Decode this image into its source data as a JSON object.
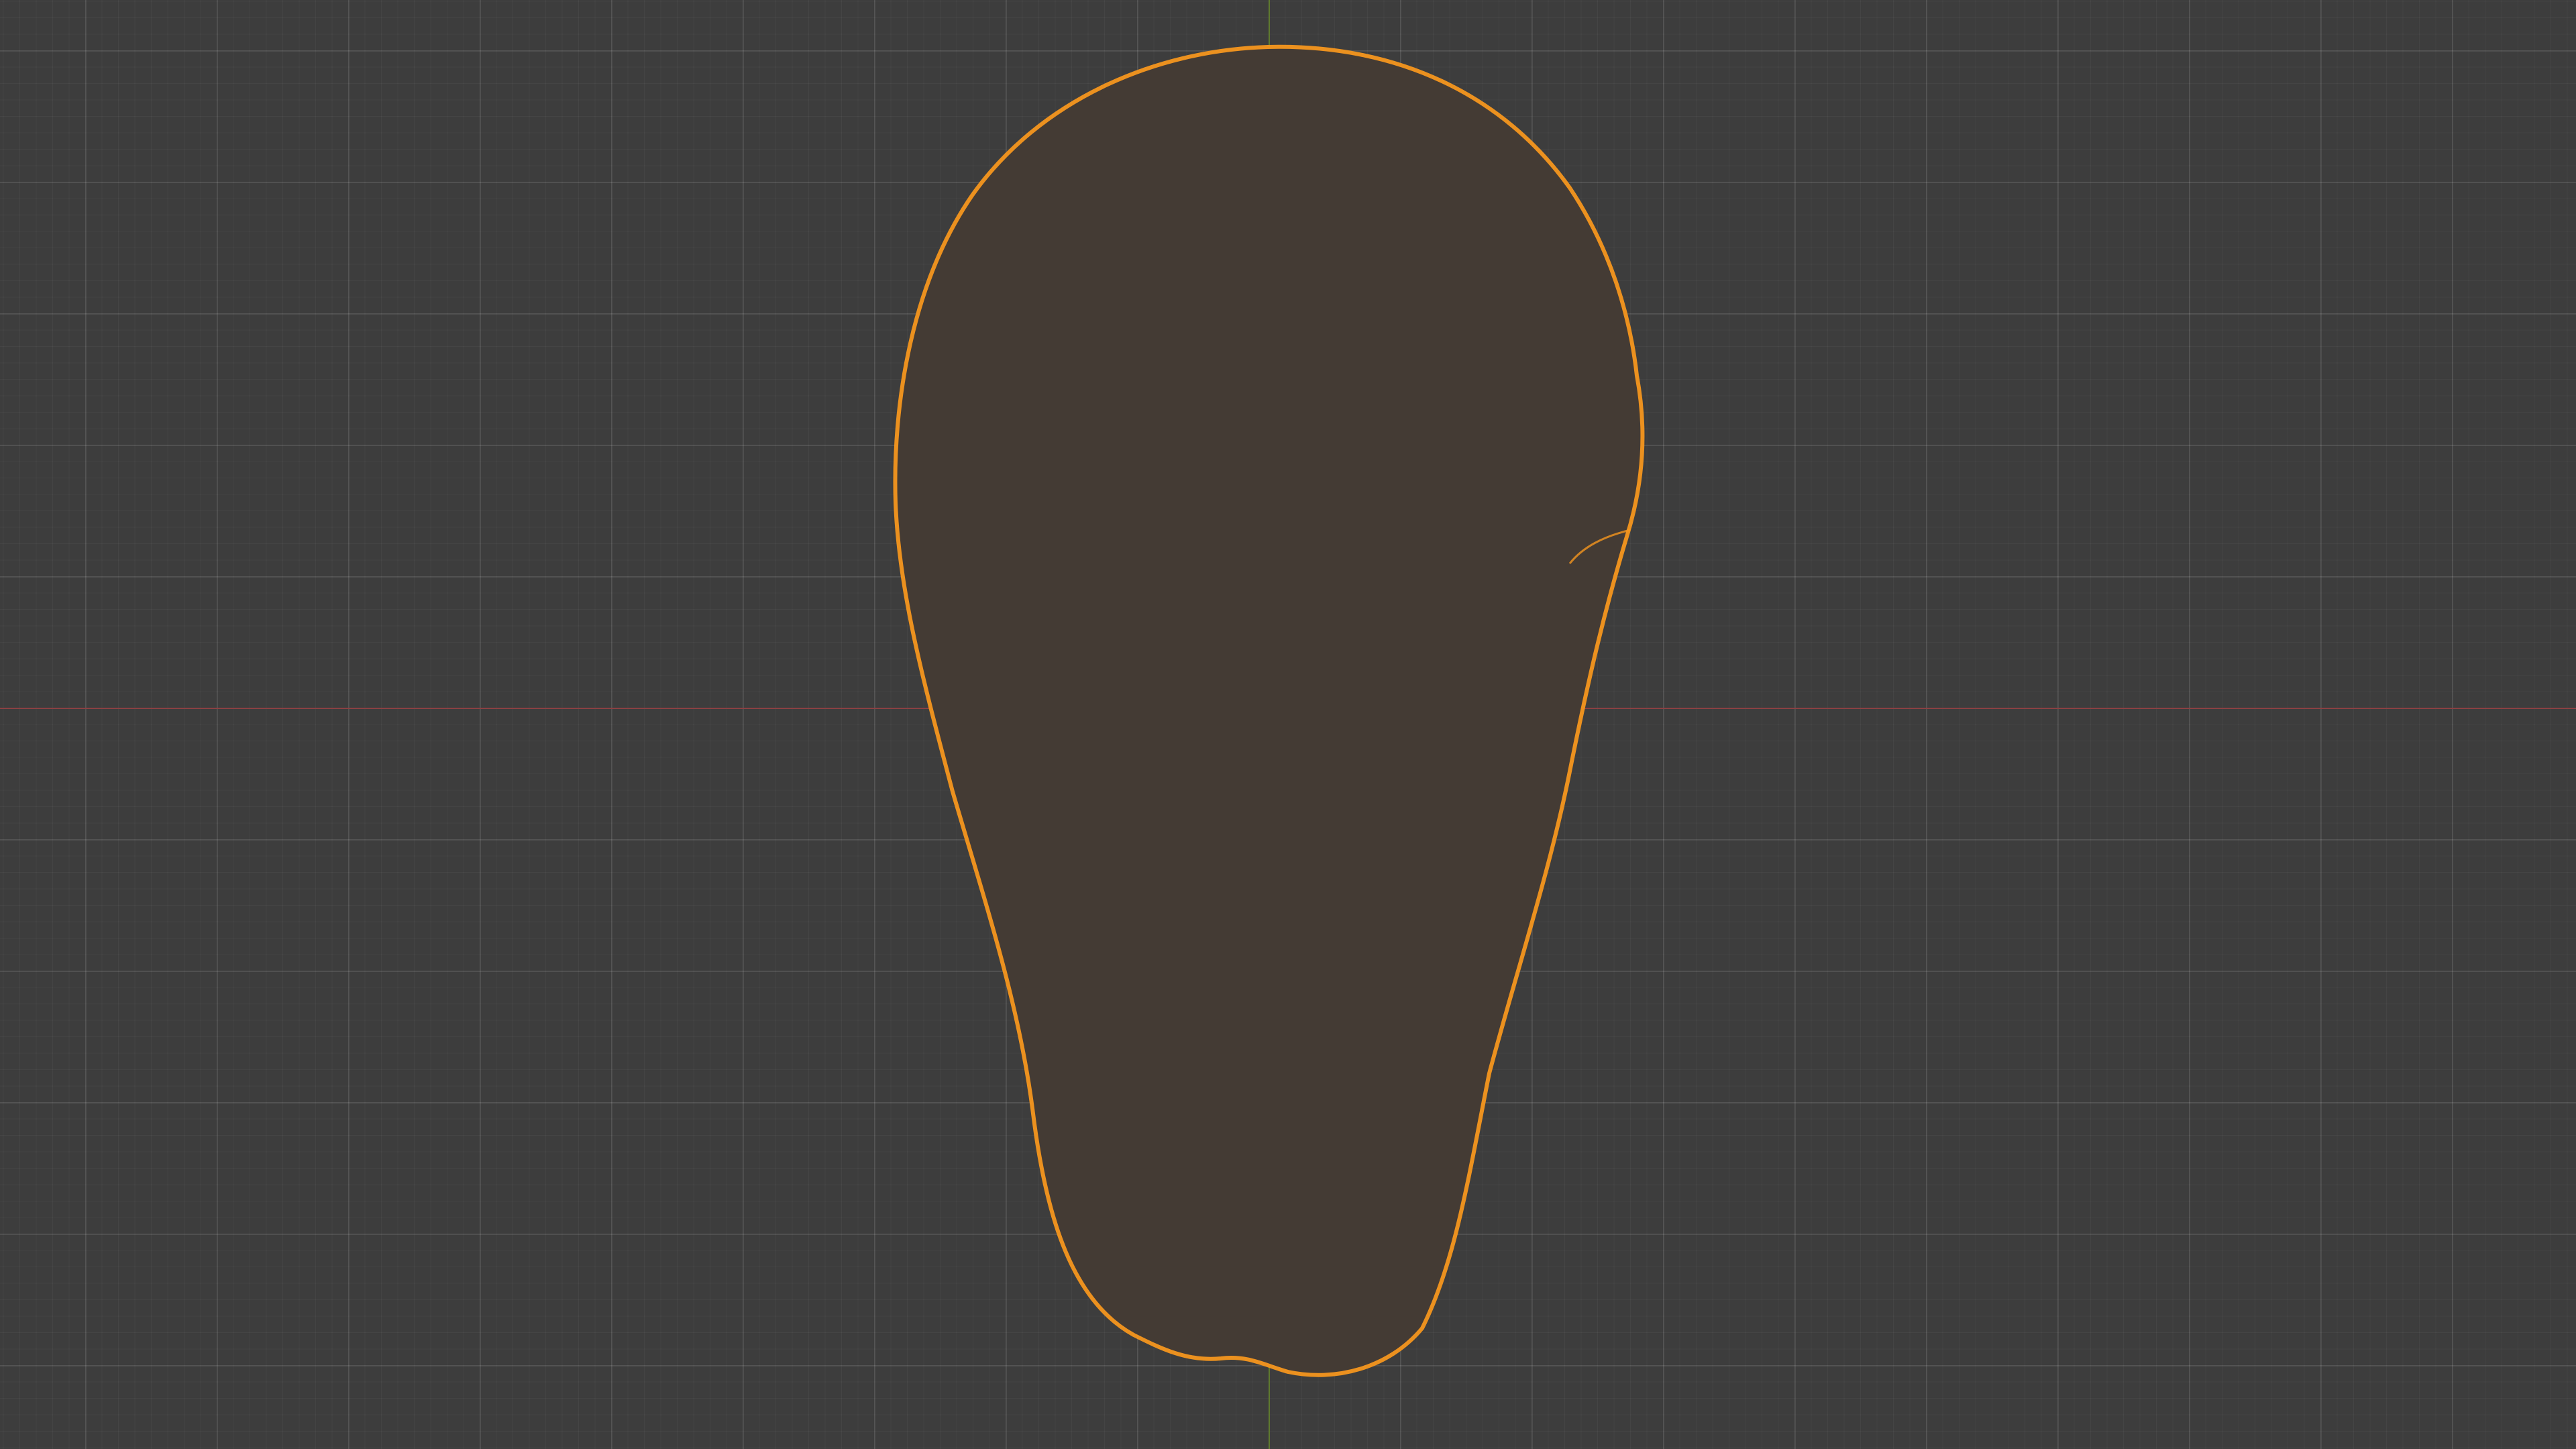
{
  "viewport": {
    "mode": "wireframe",
    "background_color": "#3d3d3d",
    "grid_color": "#4a4a4a",
    "x_axis_color": "#8a4142",
    "y_axis_color": "#5f7a2f"
  },
  "object": {
    "state": "selected",
    "wire_color": "#f5961e",
    "shape": "elongated pear/egg-shaped mesh"
  }
}
